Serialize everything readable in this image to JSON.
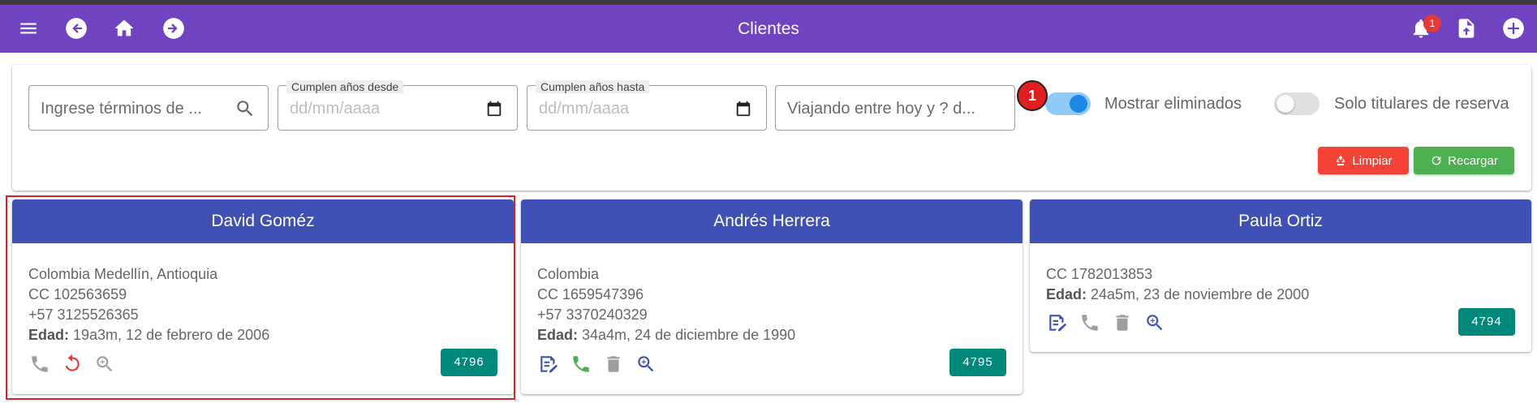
{
  "appbar": {
    "title": "Clientes",
    "notification_count": "1",
    "color": "#7043c1"
  },
  "filters": {
    "search_placeholder": "Ingrese términos de ...",
    "birthday_from_label": "Cumplen años desde",
    "birthday_from_placeholder": "dd/mm/aaaa",
    "birthday_to_label": "Cumplen años hasta",
    "birthday_to_placeholder": "dd/mm/aaaa",
    "traveling_placeholder": "Viajando entre hoy y ? d...",
    "marker_number": "1",
    "show_deleted_label": "Mostrar eliminados",
    "show_deleted_on": true,
    "only_holders_label": "Solo titulares de reserva",
    "only_holders_on": false,
    "clear_label": "Limpiar",
    "reload_label": "Recargar"
  },
  "clients": [
    {
      "name": "David Goméz",
      "lines": [
        "Colombia Medellín, Antioquia",
        "CC 102563659",
        "+57 3125526365"
      ],
      "age_label": "Edad:",
      "age_value": " 19a3m, 12 de febrero de 2006",
      "id": "4796",
      "actions": [
        "phone-icon",
        "restore-icon",
        "search-zoom-icon"
      ]
    },
    {
      "name": "Andrés Herrera",
      "lines": [
        "Colombia",
        "CC 1659547396",
        "+57 3370240329"
      ],
      "age_label": "Edad:",
      "age_value": " 34a4m, 24 de diciembre de 1990",
      "id": "4795",
      "actions": [
        "edit-note-icon",
        "phone-icon",
        "delete-icon",
        "search-zoom-icon"
      ]
    },
    {
      "name": "Paula Ortiz",
      "lines": [
        "CC 1782013853"
      ],
      "age_label": "Edad:",
      "age_value": " 24a5m, 23 de noviembre de 2000",
      "id": "4794",
      "actions": [
        "edit-note-icon",
        "phone-icon",
        "delete-icon",
        "search-zoom-icon"
      ]
    }
  ],
  "colors": {
    "card_header": "#3f51b5",
    "id_badge": "#00897b",
    "clear_button": "#f44336",
    "reload_button": "#4caf50",
    "toggle_on": "#1e88e5"
  }
}
